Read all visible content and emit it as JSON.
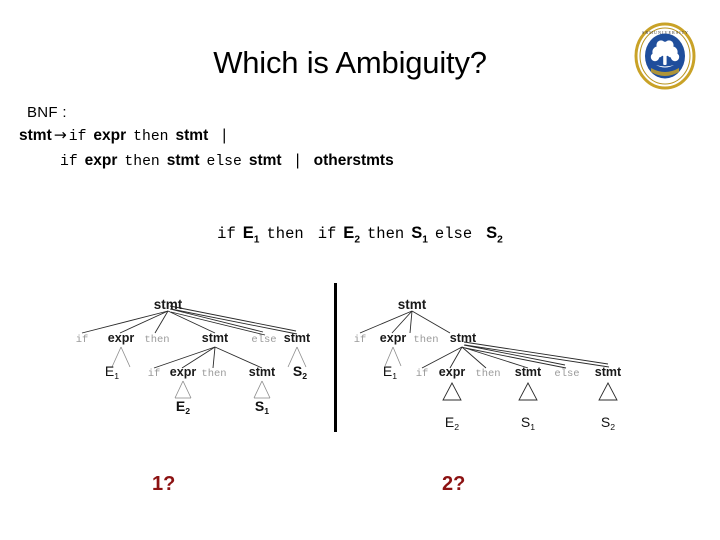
{
  "slide": {
    "title": "Which is Ambiguity?",
    "logo": {
      "name": "srm-university-seal",
      "ring_text": "S R M  U N I V E R S I T Y",
      "banner_text": "SRM UNIVERSITY",
      "gold_hex": "#c9a227",
      "blue_hex": "#1f4e9c"
    }
  },
  "bnf": {
    "label": "BNF :",
    "line1": {
      "lhs": "stmt",
      "arrow": "→",
      "t_if": "if",
      "nt_expr": "expr",
      "t_then": "then",
      "nt_stmt": "stmt",
      "bar": "|"
    },
    "line2": {
      "t_if": "if",
      "nt_expr": "expr",
      "t_then": "then",
      "nt_stmt1": "stmt",
      "t_else": "else",
      "nt_stmt2": "stmt",
      "bar": "|",
      "nt_other": "otherstmts"
    }
  },
  "sentential": {
    "t_if1": "if",
    "e1": "E",
    "e1_sub": "1",
    "t_then1": "then",
    "t_if2": "if",
    "e2": "E",
    "e2_sub": "2",
    "t_then2": "then",
    "s1": "S",
    "s1_sub": "1",
    "t_else": "else",
    "s2": "S",
    "s2_sub": "2"
  },
  "tree_left": {
    "root": "stmt",
    "row1": {
      "t_if": "if",
      "nt_expr": "expr",
      "t_then": "then",
      "nt_stmt": "stmt",
      "t_else": "else",
      "nt_stmt2": "stmt"
    },
    "row2": {
      "e1": "E",
      "e1_sub": "1",
      "t_if": "if",
      "nt_expr": "expr",
      "t_then": "then",
      "nt_stmt": "stmt",
      "s2": "S",
      "s2_sub": "2"
    },
    "row3": {
      "e2": "E",
      "e2_sub": "2",
      "s1": "S",
      "s1_sub": "1"
    }
  },
  "tree_right": {
    "root": "stmt",
    "row1": {
      "t_if": "if",
      "nt_expr": "expr",
      "t_then": "then",
      "nt_stmt": "stmt"
    },
    "row2": {
      "e1": "E",
      "e1_sub": "1",
      "t_if": "if",
      "nt_expr": "expr",
      "t_then": "then",
      "nt_stmt": "stmt",
      "t_else": "else",
      "nt_stmt2": "stmt"
    },
    "row3": {
      "e2": "E",
      "e2_sub": "2",
      "s1": "S",
      "s1_sub": "1",
      "s2": "S",
      "s2_sub": "2"
    }
  },
  "captions": {
    "left": "1?",
    "right": "2?",
    "color_hex": "#8c1212"
  }
}
